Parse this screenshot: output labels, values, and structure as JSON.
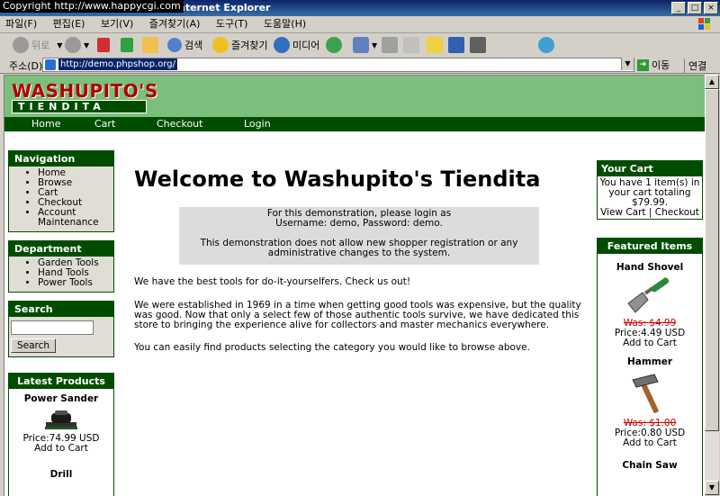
{
  "window": {
    "copyright": "Copyright   http://www.happycgi.com",
    "title": "nternet Explorer"
  },
  "menu": [
    "파일(F)",
    "편집(E)",
    "보기(V)",
    "즐겨찾기(A)",
    "도구(T)",
    "도움말(H)"
  ],
  "toolbar": {
    "back": "뒤로",
    "search": "검색",
    "favorites": "즐겨찾기",
    "media": "미디어"
  },
  "address": {
    "label": "주소(D)",
    "url": "http://demo.phpshop.org/",
    "go": "이동",
    "links": "연결"
  },
  "site": {
    "logo_top": "WASHUPITO'S",
    "logo_bottom": "TIENDITA",
    "nav": [
      "Home",
      "Cart",
      "Checkout",
      "Login"
    ]
  },
  "left": {
    "navigation": {
      "title": "Navigation",
      "items": [
        "Home",
        "Browse",
        "Cart",
        "Checkout",
        "Account Maintenance"
      ]
    },
    "department": {
      "title": "Department",
      "items": [
        "Garden Tools",
        "Hand Tools",
        "Power Tools"
      ]
    },
    "search": {
      "title": "Search",
      "button": "Search",
      "value": ""
    },
    "latest": {
      "title": "Latest Products",
      "products": [
        {
          "name": "Power Sander",
          "price": "Price:74.99 USD",
          "add": "Add to Cart"
        },
        {
          "name": "Drill"
        }
      ]
    }
  },
  "main": {
    "heading": "Welcome to Washupito's Tiendita",
    "demo_line1": "For this demonstration, please login as",
    "demo_line2": "Username: demo, Password: demo.",
    "demo_line3": "This demonstration does not allow new shopper registration or any",
    "demo_line4": "administrative changes to the system.",
    "p1": "We have the best tools for do-it-yourselfers. Check us out!",
    "p2": "We were established in 1969 in a time when getting good tools was expensive, but the quality was good. Now that only a select few of those authentic tools survive, we have dedicated this store to bringing the experience alive for collectors and master mechanics everywhere.",
    "p3": "You can easily find products selecting the category you would like to browse above."
  },
  "right": {
    "cart": {
      "title": "Your Cart",
      "text": "You have 1 item(s) in your cart totaling $79.99.",
      "view": "View Cart",
      "sep": "|",
      "checkout": "Checkout"
    },
    "featured": {
      "title": "Featured Items",
      "items": [
        {
          "name": "Hand Shovel",
          "was": "Was: $4.99",
          "price": "Price:4.49 USD",
          "add": "Add to Cart"
        },
        {
          "name": "Hammer",
          "was": "Was: $1.00",
          "price": "Price:0.80 USD",
          "add": "Add to Cart"
        },
        {
          "name": "Chain Saw"
        }
      ]
    }
  }
}
